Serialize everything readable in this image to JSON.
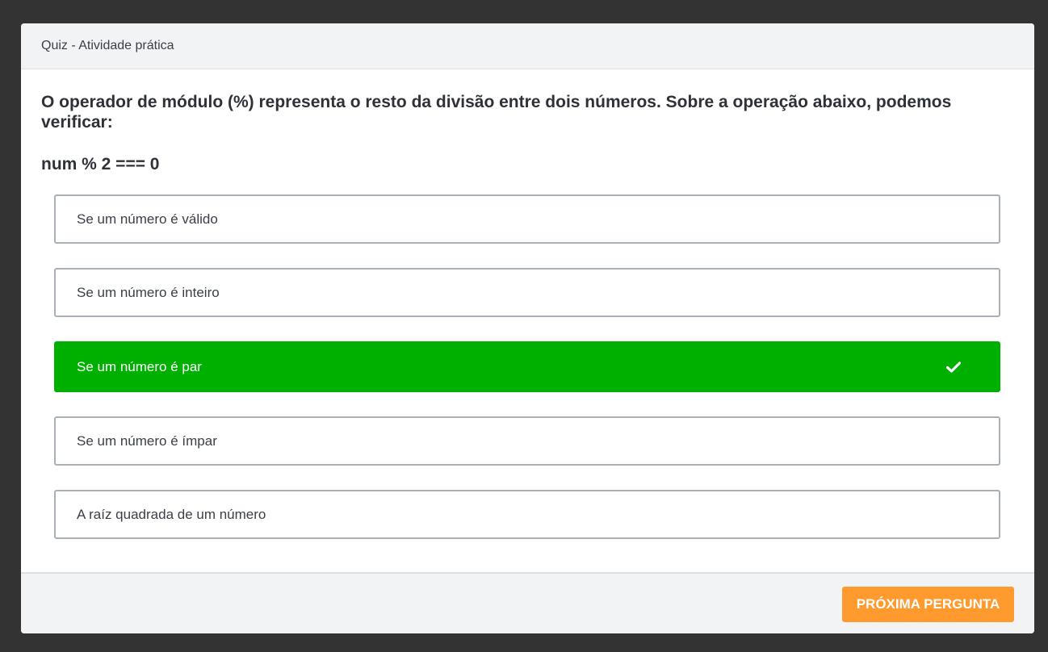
{
  "window": {
    "title": "Quiz - Atividade prática"
  },
  "question": {
    "text": "O operador de módulo (%) representa o resto da divisão entre dois números. Sobre a operação abaixo, podemos verificar:",
    "code": "num % 2 === 0"
  },
  "options": [
    {
      "label": "Se um número é válido",
      "selected": false
    },
    {
      "label": "Se um número é inteiro",
      "selected": false
    },
    {
      "label": "Se um número é par",
      "selected": true,
      "icon": "check-icon"
    },
    {
      "label": "Se um número é ímpar",
      "selected": false
    },
    {
      "label": "A raíz quadrada de um número",
      "selected": false
    }
  ],
  "footer": {
    "next_label": "PRÓXIMA PERGUNTA"
  },
  "colors": {
    "selected": "#00b000",
    "accent": "#ff9a2e",
    "backdrop": "#333333"
  }
}
